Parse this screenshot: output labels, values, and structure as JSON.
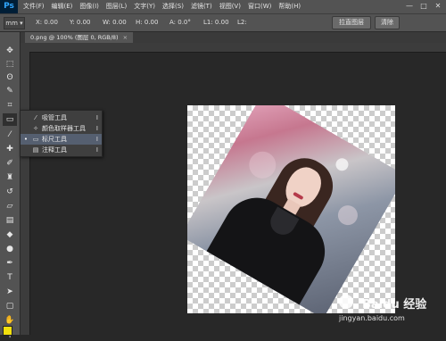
{
  "app": {
    "logo": "Ps"
  },
  "menubar": {
    "items": [
      "文件(F)",
      "编辑(E)",
      "图像(I)",
      "图层(L)",
      "文字(Y)",
      "选择(S)",
      "滤镜(T)",
      "视图(V)",
      "窗口(W)",
      "帮助(H)"
    ],
    "window_controls": [
      "—",
      "□",
      "✕"
    ]
  },
  "options": {
    "tool_preset": "mm ▾",
    "x": "X: 0.00",
    "y": "Y: 0.00",
    "w": "W: 0.00",
    "h": "H: 0.00",
    "a": "A: 0.0°",
    "l1": "L1: 0.00",
    "l2": "L2:",
    "straighten_button": "拉直图层",
    "clear_button": "清除"
  },
  "document_tab": {
    "title": "0.png @ 100% (图层 0, RGB/8)",
    "close": "×"
  },
  "tools": [
    {
      "icon": "move-icon",
      "glyph": "✥"
    },
    {
      "icon": "marquee-icon",
      "glyph": "⬚"
    },
    {
      "icon": "lasso-icon",
      "glyph": "ʘ"
    },
    {
      "icon": "quick-select-icon",
      "glyph": "✎"
    },
    {
      "icon": "crop-icon",
      "glyph": "⌗"
    },
    {
      "icon": "ruler-icon",
      "glyph": "▭"
    },
    {
      "icon": "eyedropper-icon",
      "glyph": "⁄"
    },
    {
      "icon": "healing-icon",
      "glyph": "✚"
    },
    {
      "icon": "brush-icon",
      "glyph": "✐"
    },
    {
      "icon": "stamp-icon",
      "glyph": "♜"
    },
    {
      "icon": "history-brush-icon",
      "glyph": "↺"
    },
    {
      "icon": "eraser-icon",
      "glyph": "▱"
    },
    {
      "icon": "gradient-icon",
      "glyph": "▤"
    },
    {
      "icon": "blur-icon",
      "glyph": "◆"
    },
    {
      "icon": "dodge-icon",
      "glyph": "●"
    },
    {
      "icon": "pen-icon",
      "glyph": "✒"
    },
    {
      "icon": "type-icon",
      "glyph": "T"
    },
    {
      "icon": "path-select-icon",
      "glyph": "➤"
    },
    {
      "icon": "shape-icon",
      "glyph": "▢"
    },
    {
      "icon": "hand-icon",
      "glyph": "✋"
    },
    {
      "icon": "zoom-icon",
      "glyph": "⚲"
    }
  ],
  "flyout": {
    "items": [
      {
        "label": "吸管工具",
        "key": "I",
        "icon": "eyedropper-icon",
        "glyph": "⁄",
        "selected": false
      },
      {
        "label": "颜色取样器工具",
        "key": "I",
        "icon": "color-sampler-icon",
        "glyph": "✧",
        "selected": false
      },
      {
        "label": "标尺工具",
        "key": "I",
        "icon": "ruler-icon",
        "glyph": "▭",
        "selected": true
      },
      {
        "label": "注释工具",
        "key": "I",
        "icon": "note-icon",
        "glyph": "▤",
        "selected": false
      }
    ],
    "bullet": "•"
  },
  "watermark": {
    "brand": "Baidu 经验",
    "url": "jingyan.baidu.com"
  },
  "colors": {
    "foreground": "#f2e00e",
    "accent": "#31a8ff"
  }
}
